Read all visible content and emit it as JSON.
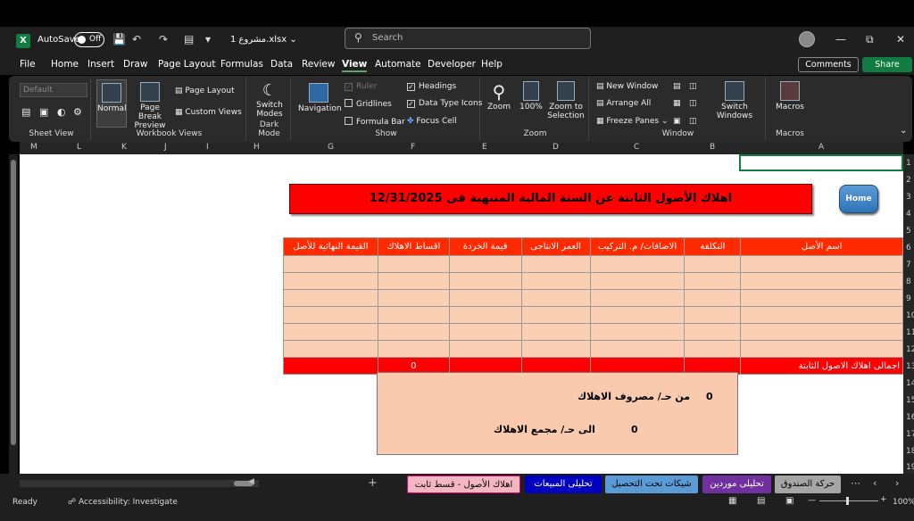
{
  "titlebar": {
    "autosave_label": "AutoSave",
    "autosave_state": "Off",
    "filename": "مشروع 1.xlsx",
    "search_placeholder": "Search"
  },
  "menu": {
    "items": [
      "File",
      "Home",
      "Insert",
      "Draw",
      "Page Layout",
      "Formulas",
      "Data",
      "Review",
      "View",
      "Automate",
      "Developer",
      "Help"
    ],
    "active": "View",
    "comments": "Comments",
    "share": "Share"
  },
  "ribbon": {
    "sheet_view": {
      "dropdown_value": "Default",
      "label": "Sheet View"
    },
    "workbook_views": {
      "normal": "Normal",
      "page_break": "Page Break Preview",
      "page_layout": "Page Layout",
      "custom_views": "Custom Views",
      "label": "Workbook Views"
    },
    "dark_mode": {
      "switch_modes": "Switch Modes",
      "label": "Dark Mode"
    },
    "show": {
      "navigation": "Navigation",
      "ruler": "Ruler",
      "gridlines": "Gridlines",
      "formula_bar": "Formula Bar",
      "headings": "Headings",
      "data_type_icons": "Data Type Icons",
      "focus_cell": "Focus Cell",
      "label": "Show"
    },
    "zoom": {
      "zoom": "Zoom",
      "hundred": "100%",
      "zoom_to_selection": "Zoom to Selection",
      "label": "Zoom"
    },
    "window": {
      "new_window": "New Window",
      "arrange_all": "Arrange All",
      "freeze_panes": "Freeze Panes",
      "switch_windows": "Switch Windows",
      "label": "Window"
    },
    "macros": {
      "macros": "Macros",
      "label": "Macros"
    }
  },
  "columns": [
    "M",
    "L",
    "K",
    "J",
    "I",
    "H",
    "G",
    "F",
    "E",
    "D",
    "C",
    "B",
    "A"
  ],
  "rows": [
    "1",
    "2",
    "3",
    "4",
    "5",
    "6",
    "7",
    "8",
    "9",
    "10",
    "11",
    "12",
    "13",
    "14",
    "15",
    "16",
    "17",
    "18",
    "19"
  ],
  "sheet": {
    "title": "اهلاك الأصول الثابتة عن السنة المالية المنتهية فى 12/31/2025",
    "home_button": "Home",
    "table_headers": [
      "القيمة النهائية للأصل",
      "اقساط الاهلاك",
      "قيمة الخردة",
      "العمر الانتاجى",
      "الاضافات/ م. التركيب",
      "التكلفة",
      "اسم الأصل"
    ],
    "total_label": "اجمالى اهلاك الاصول الثابتة",
    "total_value": "0",
    "summary": {
      "line1_label": "من حـ/ مصروف الاهلاك",
      "line1_value": "0",
      "line2_label": "الى حـ/ مجمع الاهلاك",
      "line2_value": "0"
    }
  },
  "tabs": [
    {
      "label": "حركة الصندوق",
      "color": "#a6a6a6"
    },
    {
      "label": "تحليلى موردين",
      "color": "#7030a0"
    },
    {
      "label": "شيكات تحت التحصيل",
      "color": "#5b9bd5"
    },
    {
      "label": "تحليلى المبيعات",
      "color": "#0000c0"
    },
    {
      "label": "اهلاك الأصول - قسط ثابت",
      "color": "#f4b6c2"
    }
  ],
  "status": {
    "ready": "Ready",
    "accessibility": "Accessibility: Investigate",
    "zoom": "100%"
  }
}
